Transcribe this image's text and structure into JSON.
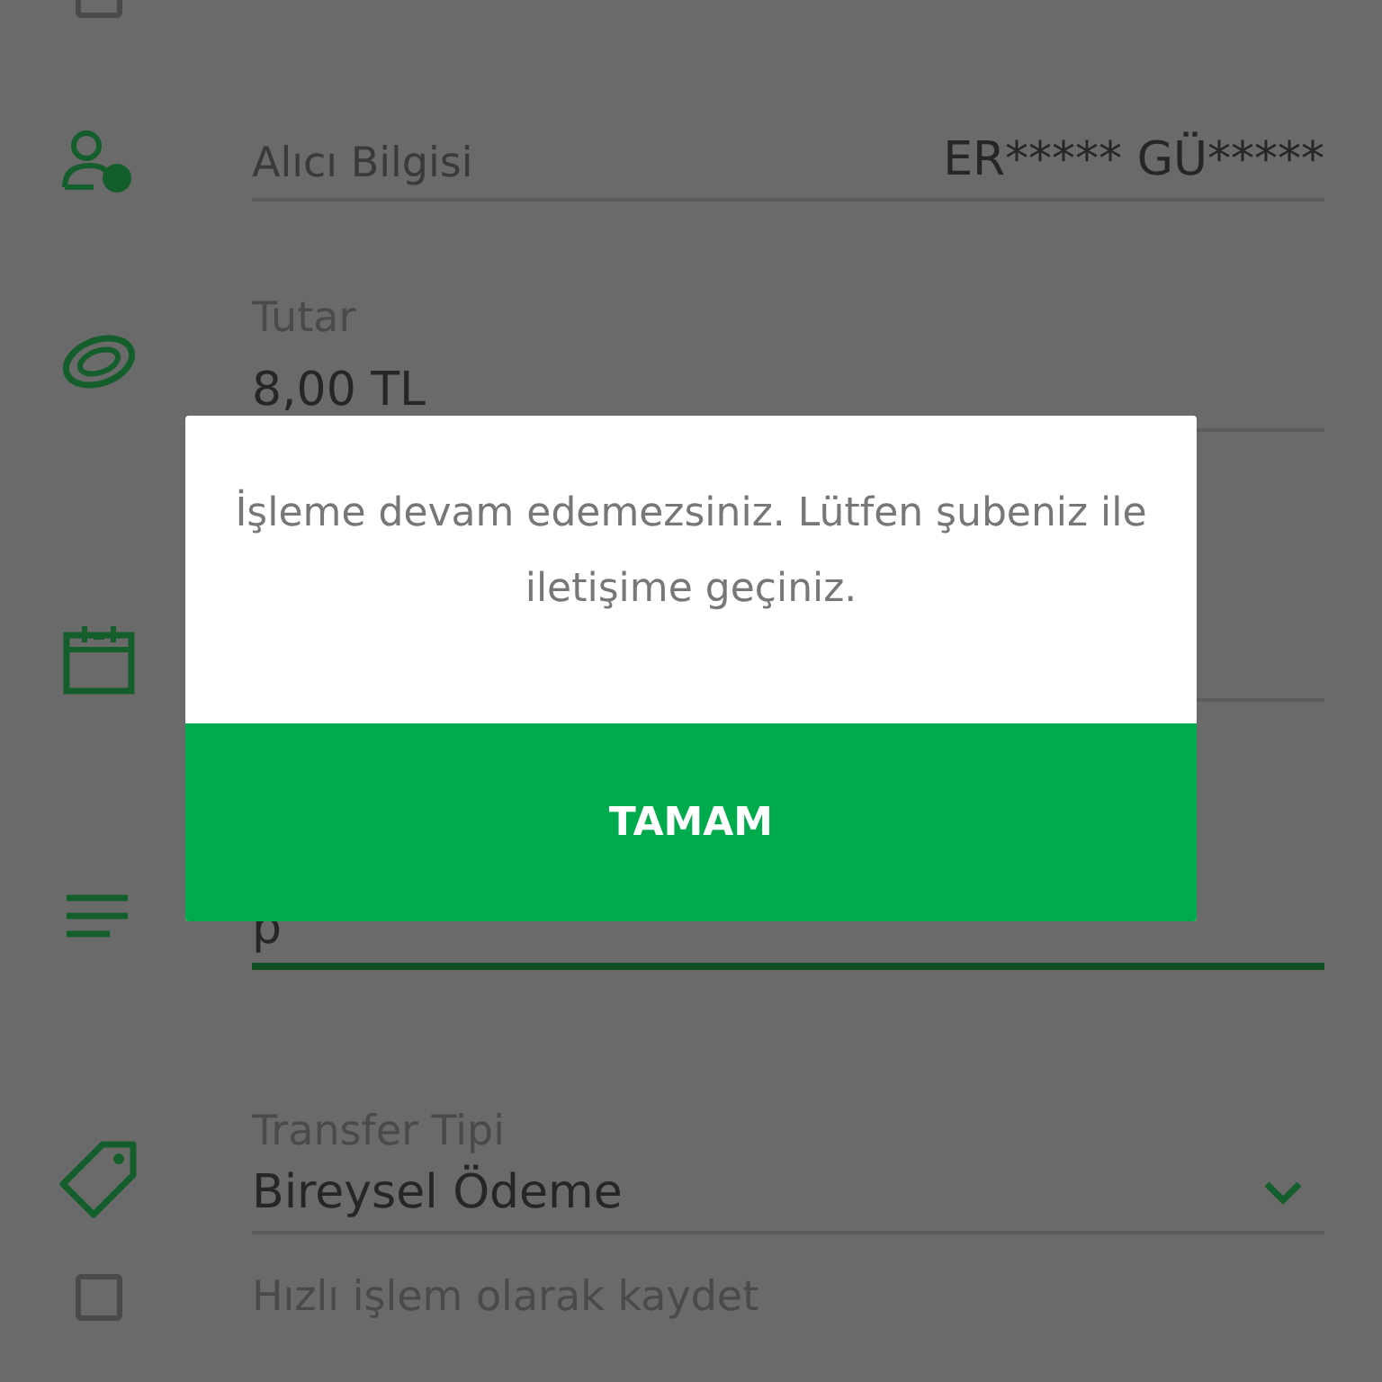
{
  "top_checkbox": {
    "checked": false
  },
  "recipient": {
    "label": "Alıcı Bilgisi",
    "value": "ER***** GÜ*****"
  },
  "amount": {
    "label": "Tutar",
    "value": "8,00 TL"
  },
  "description": {
    "value": "p",
    "focused": true
  },
  "transfer_type": {
    "label": "Transfer Tipi",
    "value": "Bireysel Ödeme"
  },
  "quick_save": {
    "label": "Hızlı işlem olarak kaydet",
    "checked": false
  },
  "dialog": {
    "message": "İşleme devam edemezsiniz. Lütfen şubeniz ile iletişime geçiniz.",
    "button": "TAMAM"
  }
}
